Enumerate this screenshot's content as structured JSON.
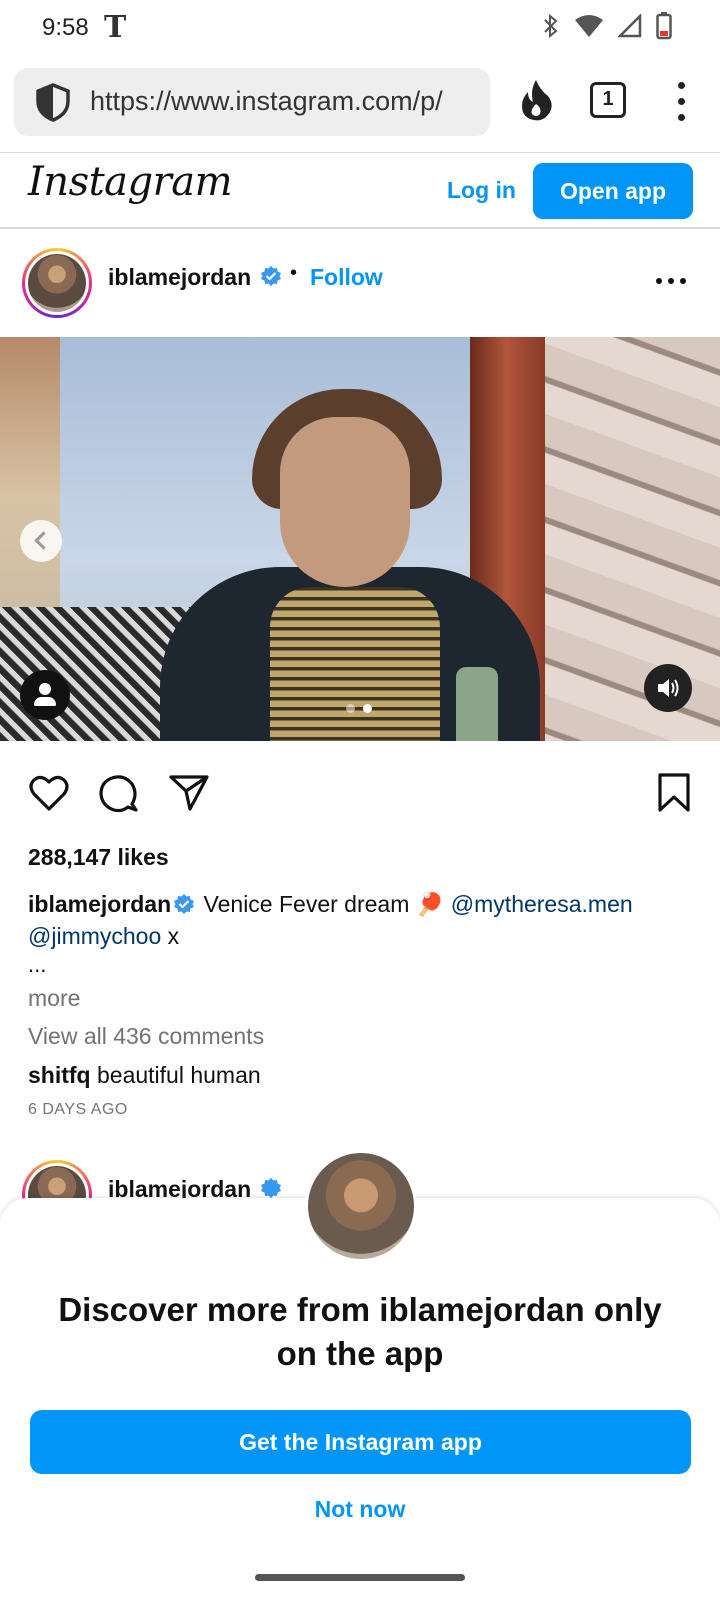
{
  "status_bar": {
    "time": "9:58",
    "carrier_glyph": "T",
    "icons": [
      "bluetooth-icon",
      "wifi-icon",
      "signal-icon",
      "battery-icon"
    ]
  },
  "browser": {
    "url": "https://www.instagram.com/p/",
    "tab_count": "1"
  },
  "header": {
    "logo": "Instagram",
    "login_label": "Log in",
    "open_app_label": "Open app"
  },
  "post": {
    "username": "iblamejordan",
    "separator": "•",
    "follow_label": "Follow",
    "carousel": {
      "slides": 2,
      "active_index": 1
    },
    "likes": "288,147 likes",
    "caption": {
      "user": "iblamejordan",
      "text": "Venice Fever dream 🏓",
      "mention1": "@mytheresa.men",
      "mention2": "@jimmychoo",
      "trailing": "x"
    },
    "ellipsis": "...",
    "more_label": "more",
    "view_comments": "View all 436 comments",
    "comment": {
      "user": "shitfq",
      "text": "beautiful human"
    },
    "timestamp": "6 DAYS AGO"
  },
  "next_post": {
    "username": "iblamejordan"
  },
  "sheet": {
    "title": "Discover more from iblamejordan only on the app",
    "get_app_label": "Get the Instagram app",
    "not_now_label": "Not now"
  },
  "colors": {
    "brand_blue": "#0095f6",
    "mention_blue": "#00376b",
    "muted_text": "#737373",
    "verified_blue": "#3897f0"
  }
}
